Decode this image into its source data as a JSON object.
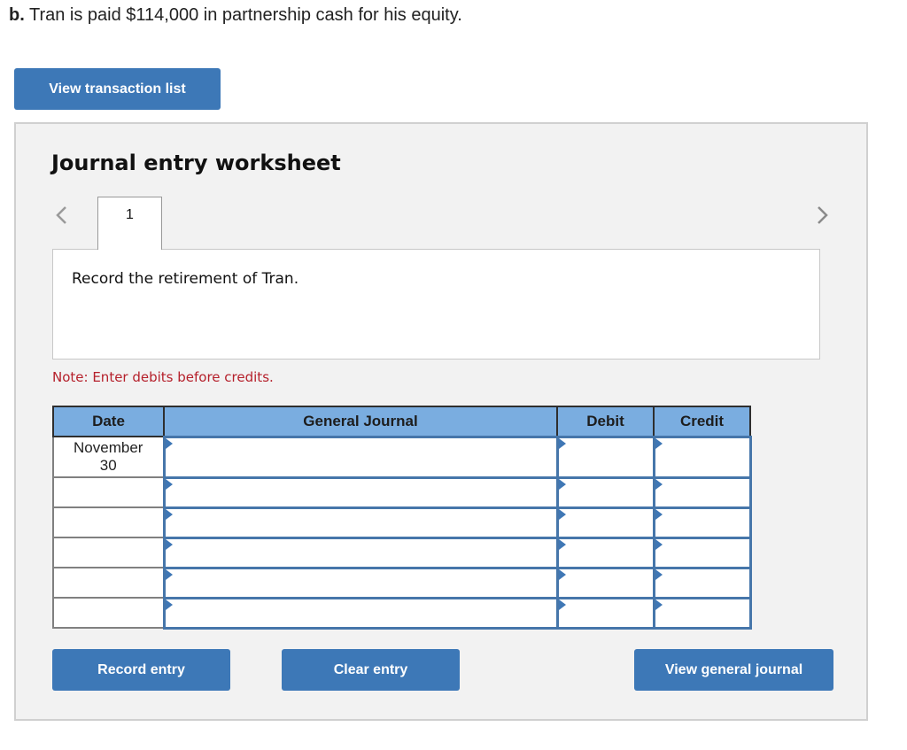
{
  "question": {
    "label": "b.",
    "text": " Tran is paid $114,000 in partnership cash for his equity."
  },
  "buttons": {
    "view_transaction_list": "View transaction list",
    "record_entry": "Record entry",
    "clear_entry": "Clear entry",
    "view_general_journal": "View general journal"
  },
  "worksheet": {
    "title": "Journal entry worksheet",
    "prev_icon": "chevron-left-icon",
    "next_icon": "chevron-right-icon",
    "tabs": [
      {
        "label": "1",
        "active": true
      }
    ],
    "prompt": "Record the retirement of Tran.",
    "note": "Note: Enter debits before credits."
  },
  "journal": {
    "headers": {
      "date": "Date",
      "account": "General Journal",
      "debit": "Debit",
      "credit": "Credit"
    },
    "rows": [
      {
        "date_line1": "November",
        "date_line2": "30",
        "account": "",
        "debit": "",
        "credit": ""
      },
      {
        "date_line1": "",
        "date_line2": "",
        "account": "",
        "debit": "",
        "credit": ""
      },
      {
        "date_line1": "",
        "date_line2": "",
        "account": "",
        "debit": "",
        "credit": ""
      },
      {
        "date_line1": "",
        "date_line2": "",
        "account": "",
        "debit": "",
        "credit": ""
      },
      {
        "date_line1": "",
        "date_line2": "",
        "account": "",
        "debit": "",
        "credit": ""
      },
      {
        "date_line1": "",
        "date_line2": "",
        "account": "",
        "debit": "",
        "credit": ""
      }
    ]
  },
  "colors": {
    "button_blue": "#3d78b7",
    "header_blue": "#7aade0",
    "note_red": "#b5202b",
    "panel_bg": "#f2f2f2"
  }
}
